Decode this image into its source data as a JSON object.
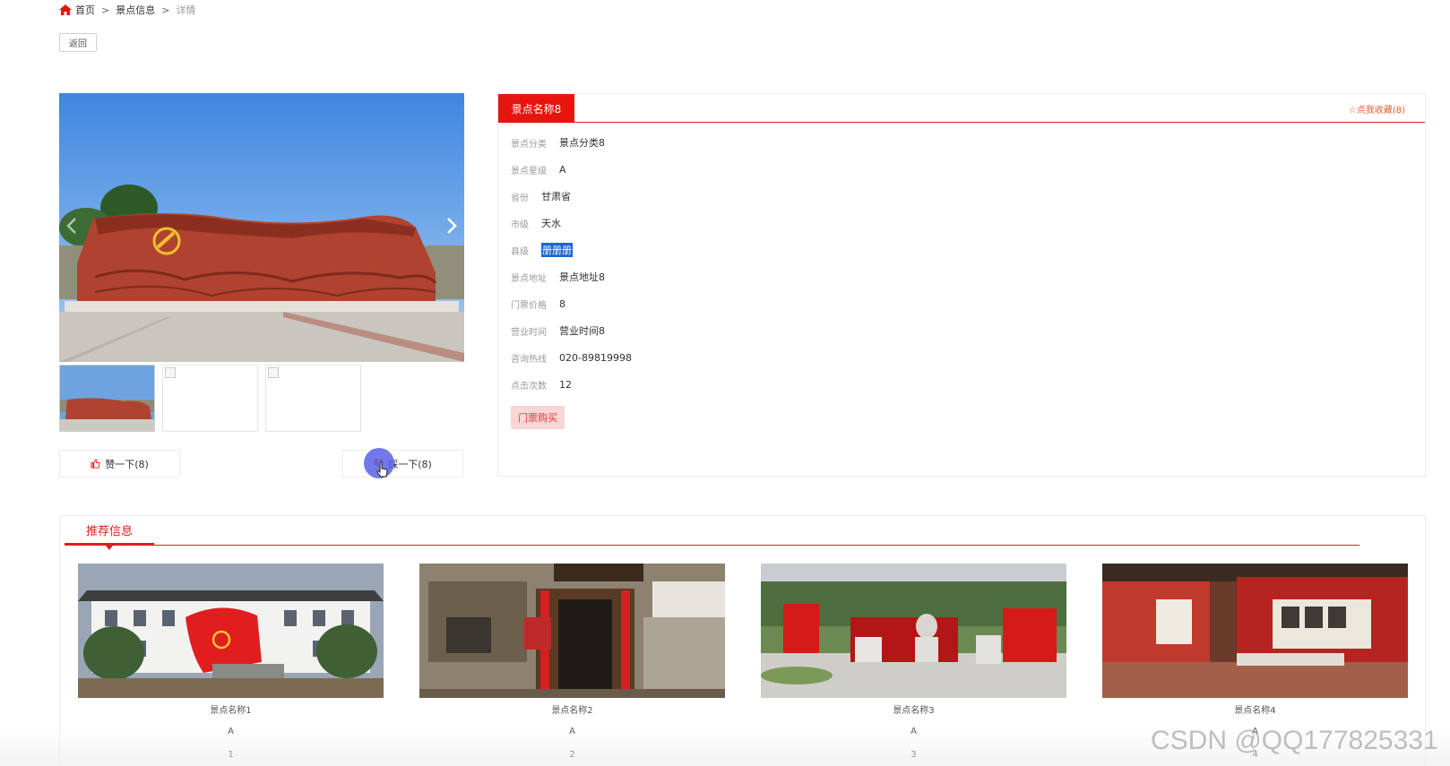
{
  "breadcrumb": {
    "home": "首页",
    "sep1": ">",
    "section": "景点信息",
    "sep2": ">",
    "current": "详情"
  },
  "back_label": "返回",
  "gallery": {
    "thumbnail_count": 3,
    "like_label": "赞一下(8)",
    "dislike_label": "踩一下(8)"
  },
  "detail": {
    "name": "景点名称8",
    "favorite_label": "☆点我收藏(8)",
    "fields": [
      {
        "label": "景点分类",
        "value": "景点分类8"
      },
      {
        "label": "景点星级",
        "value": "A"
      },
      {
        "label": "省份",
        "value": "甘肃省"
      },
      {
        "label": "市级",
        "value": "天水"
      },
      {
        "label": "县级",
        "value": "册册册"
      },
      {
        "label": "景点地址",
        "value": "景点地址8"
      },
      {
        "label": "门票价格",
        "value": "8"
      },
      {
        "label": "营业时间",
        "value": "营业时间8"
      },
      {
        "label": "咨询热线",
        "value": "020-89819998"
      },
      {
        "label": "点击次数",
        "value": "12"
      }
    ],
    "buy_label": "门票购买"
  },
  "recommend": {
    "title": "推荐信息",
    "items": [
      {
        "name": "景点名称1",
        "level": "A",
        "count": "1"
      },
      {
        "name": "景点名称2",
        "level": "A",
        "count": "2"
      },
      {
        "name": "景点名称3",
        "level": "A",
        "count": "3"
      },
      {
        "name": "景点名称4",
        "level": "A",
        "count": "4"
      }
    ]
  },
  "watermark": "CSDN @QQ177825331",
  "colors": {
    "accent": "#e8150f",
    "buy_bg": "#f9d5d5",
    "favorite": "#e06030"
  }
}
